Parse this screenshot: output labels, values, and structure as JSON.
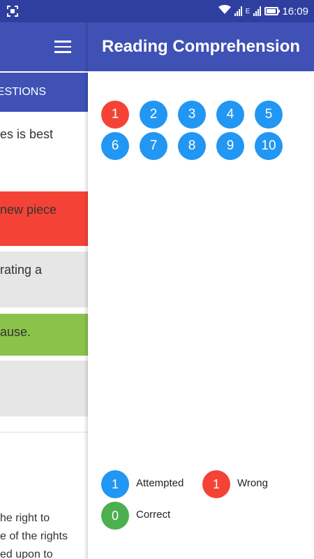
{
  "status_bar": {
    "time": "16:09",
    "network_label": "E"
  },
  "background_page": {
    "tab_label": "QUESTIONS",
    "question_fragment": "es is best",
    "options": [
      {
        "text": "new piece",
        "color": "#f44336"
      },
      {
        "text": "rating a",
        "color": "#e6e6e6"
      },
      {
        "text": "ause.",
        "color": "#8bc34a"
      },
      {
        "text": "",
        "color": "#e6e6e6"
      }
    ],
    "passage_lines": [
      "he right to",
      "e of the rights",
      "ed upon to"
    ]
  },
  "drawer": {
    "title": "Reading Comprehension",
    "questions": [
      {
        "number": "1",
        "status": "wrong"
      },
      {
        "number": "2",
        "status": "attempted"
      },
      {
        "number": "3",
        "status": "attempted"
      },
      {
        "number": "4",
        "status": "attempted"
      },
      {
        "number": "5",
        "status": "attempted"
      },
      {
        "number": "6",
        "status": "attempted"
      },
      {
        "number": "7",
        "status": "attempted"
      },
      {
        "number": "8",
        "status": "attempted"
      },
      {
        "number": "9",
        "status": "attempted"
      },
      {
        "number": "10",
        "status": "attempted"
      }
    ],
    "legend": {
      "attempted": {
        "count": "1",
        "label": "Attempted"
      },
      "wrong": {
        "count": "1",
        "label": "Wrong"
      },
      "correct": {
        "count": "0",
        "label": "Correct"
      }
    }
  },
  "colors": {
    "primary": "#3f51b5",
    "primary_dark": "#2f3fa0",
    "attempted": "#2196f3",
    "wrong": "#f44336",
    "correct": "#4caf50",
    "option_correct": "#8bc34a",
    "option_wrong": "#f44336",
    "option_neutral": "#e6e6e6"
  }
}
